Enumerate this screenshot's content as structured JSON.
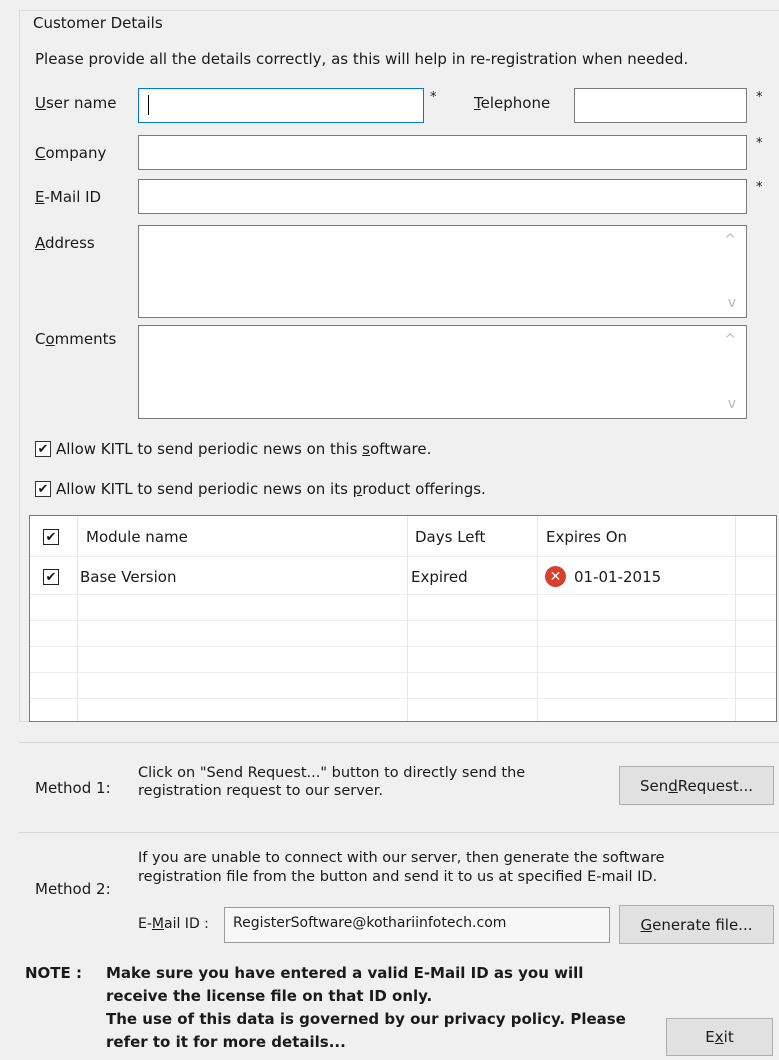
{
  "customer_details": {
    "group_title": "Customer Details",
    "intro": "Please provide all the details correctly, as this will help in re-registration when needed.",
    "user_name": {
      "label_pre": "",
      "label_key": "U",
      "label_post": "ser name",
      "value": "",
      "required": "*"
    },
    "telephone": {
      "label_pre": "",
      "label_key": "T",
      "label_post": "elephone",
      "value": "",
      "required": "*"
    },
    "company": {
      "label_pre": "",
      "label_key": "C",
      "label_post": "ompany",
      "value": "",
      "required": "*"
    },
    "email": {
      "label_pre": "",
      "label_key": "E",
      "label_post": "-Mail ID",
      "value": "",
      "required": "*"
    },
    "address": {
      "label_pre": "",
      "label_key": "A",
      "label_post": "ddress",
      "value": ""
    },
    "comments": {
      "label_pre": "C",
      "label_key": "o",
      "label_post": "mments",
      "value": ""
    },
    "scroll_up": "^",
    "scroll_down": "v"
  },
  "options": [
    {
      "pre": "Allow KITL to send periodic news on this ",
      "key": "s",
      "post": "oftware.",
      "checked": true
    },
    {
      "pre": "Allow KITL to send periodic news on its ",
      "key": "p",
      "post": "roduct offerings.",
      "checked": true
    }
  ],
  "modules": {
    "columns": [
      "Module name",
      "Days Left",
      "Expires On"
    ],
    "header_checked": true,
    "rows": [
      {
        "name": "Base Version",
        "days_left": "Expired",
        "expires_on": "01-01-2015",
        "checked": true,
        "status_icon": "error-icon"
      }
    ]
  },
  "method1": {
    "label": "Method 1:",
    "text_line1": "Click on \"Send Request...\" button to directly send the",
    "text_line2": "registration request to our server.",
    "button_pre": "Sen",
    "button_key": "d",
    "button_post": " Request..."
  },
  "method2": {
    "label": "Method 2:",
    "text_line1": "If you are unable to connect with our server, then generate the software",
    "text_line2": "registration file from the button and send it to us at specified E-mail ID.",
    "email_label_pre": "E-",
    "email_label_key": "M",
    "email_label_post": "ail ID :",
    "email_value": "RegisterSoftware@kothariinfotech.com",
    "button_pre": "",
    "button_key": "G",
    "button_post": "enerate file..."
  },
  "note": {
    "label": "NOTE :",
    "line1": "Make sure you have entered a valid E-Mail ID as you will",
    "line2": "receive the license file on that ID only.",
    "line3": "The use of this data is governed by our privacy policy.  Please",
    "line4": "refer to it for more details..."
  },
  "exit_button": {
    "pre": "E",
    "key": "x",
    "post": "it"
  },
  "icons": {
    "check": "✔",
    "error": "✕"
  },
  "colors": {
    "focus_border": "#0078d7",
    "error_red": "#d9402b",
    "background": "#f0f0f0"
  }
}
